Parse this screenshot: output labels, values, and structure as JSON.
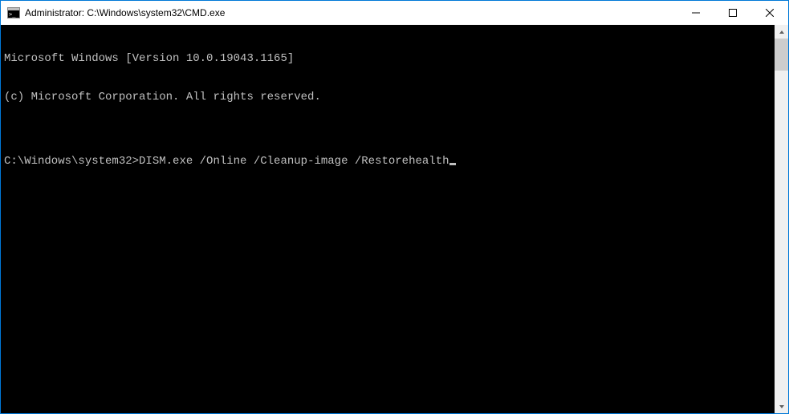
{
  "titlebar": {
    "title": "Administrator: C:\\Windows\\system32\\CMD.exe"
  },
  "terminal": {
    "line1": "Microsoft Windows [Version 10.0.19043.1165]",
    "line2": "(c) Microsoft Corporation. All rights reserved.",
    "blank": "",
    "prompt": "C:\\Windows\\system32>",
    "command": "DISM.exe /Online /Cleanup-image /Restorehealth"
  }
}
